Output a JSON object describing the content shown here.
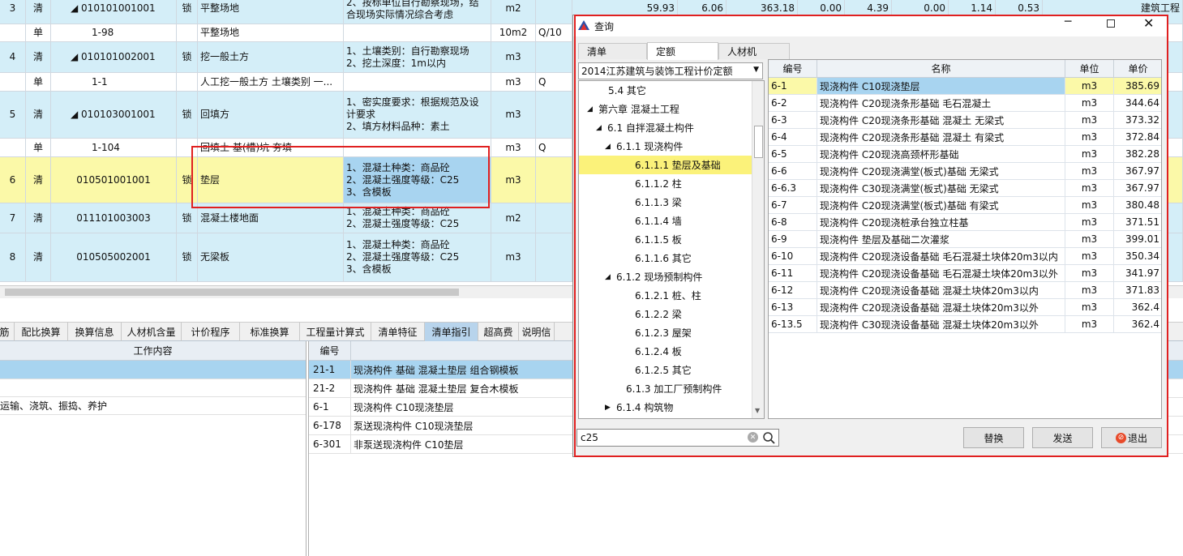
{
  "grid": {
    "rows": [
      {
        "no": "3",
        "type": "清",
        "code": "◢ 010101001001",
        "lock": "锁",
        "name": "平整场地",
        "feature": "2、按标单位自行勘察现场，结合现场实际情况综合考虑",
        "unit": "m2",
        "qty": "",
        "n1": "59.93",
        "n2": "6.06",
        "n3": "363.18",
        "n4": "0.00",
        "n5": "4.39",
        "n6": "0.00",
        "n7": "1.14",
        "n8": "0.53",
        "cat": "建筑工程"
      },
      {
        "no": "",
        "type": "单",
        "code": "1-98",
        "lock": "",
        "name": "平整场地",
        "feature": "",
        "unit": "10m2",
        "qty": "Q/10"
      },
      {
        "no": "4",
        "type": "清",
        "code": "◢ 010101002001",
        "lock": "锁",
        "name": "挖一般土方",
        "feature": "1、土壤类别：自行勘察现场\n2、挖土深度：1m以内",
        "unit": "m3",
        "qty": ""
      },
      {
        "no": "",
        "type": "单",
        "code": "1-1",
        "lock": "",
        "name": "人工挖一般土方 土壤类别 一...",
        "feature": "",
        "unit": "m3",
        "qty": "Q"
      },
      {
        "no": "5",
        "type": "清",
        "code": "◢ 010103001001",
        "lock": "锁",
        "name": "回填方",
        "feature": "1、密实度要求：根据规范及设计要求\n2、填方材料品种：素土",
        "unit": "m3",
        "qty": ""
      },
      {
        "no": "",
        "type": "单",
        "code": "1-104",
        "lock": "",
        "name": "回填土 基(槽)坑 夯填",
        "feature": "",
        "unit": "m3",
        "qty": "Q"
      },
      {
        "no": "6",
        "type": "清",
        "code": "010501001001",
        "lock": "锁",
        "name": "垫层",
        "feature": "1、混凝土种类：商品砼\n2、混凝土强度等级：C25\n3、含模板",
        "unit": "m3",
        "qty": ""
      },
      {
        "no": "7",
        "type": "清",
        "code": "011101003003",
        "lock": "锁",
        "name": "混凝土楼地面",
        "feature": "1、混凝土种类：商品砼\n2、混凝土强度等级：C25",
        "unit": "m2",
        "qty": ""
      },
      {
        "no": "8",
        "type": "清",
        "code": "010505002001",
        "lock": "锁",
        "name": "无梁板",
        "feature": "1、混凝土种类：商品砼\n2、混凝土强度等级：C25\n3、含模板",
        "unit": "m3",
        "qty": ""
      }
    ]
  },
  "tabs": [
    "筋",
    "配比换算",
    "换算信息",
    "人材机含量",
    "计价程序",
    "标准换算",
    "工程量计算式",
    "清单特征",
    "清单指引",
    "超高费",
    "说明信"
  ],
  "active_tab": "清单指引",
  "left_panel": {
    "header": "工作内容",
    "rows": [
      "",
      "",
      "运输、浇筑、振捣、养护"
    ]
  },
  "right_panel": {
    "header_code": "编号",
    "rows": [
      {
        "code": "21-1",
        "name": "现浇构件 基础 混凝土垫层 组合钢模板"
      },
      {
        "code": "21-2",
        "name": "现浇构件 基础 混凝土垫层 复合木模板"
      },
      {
        "code": "6-1",
        "name": "现浇构件  C10现浇垫层"
      },
      {
        "code": "6-178",
        "name": "泵送现浇构件  C10现浇垫层"
      },
      {
        "code": "6-301",
        "name": "非泵送现浇构件  C10垫层"
      }
    ]
  },
  "dialog": {
    "title": "查询",
    "tabs": [
      "清单",
      "定额",
      "人材机"
    ],
    "active_tab": "定额",
    "combo": "2014江苏建筑与装饰工程计价定额",
    "tree": [
      {
        "label": "5.4 其它",
        "indent": 0,
        "exp": ""
      },
      {
        "label": "第六章 混凝土工程",
        "indent": 0,
        "exp": "◢"
      },
      {
        "label": "6.1 自拌混凝土构件",
        "indent": 1,
        "exp": "◢"
      },
      {
        "label": "6.1.1 现浇构件",
        "indent": 2,
        "exp": "◢"
      },
      {
        "label": "6.1.1.1 垫层及基础",
        "indent": 3,
        "exp": "",
        "sel": true
      },
      {
        "label": "6.1.1.2 柱",
        "indent": 3,
        "exp": ""
      },
      {
        "label": "6.1.1.3 梁",
        "indent": 3,
        "exp": ""
      },
      {
        "label": "6.1.1.4 墙",
        "indent": 3,
        "exp": ""
      },
      {
        "label": "6.1.1.5 板",
        "indent": 3,
        "exp": ""
      },
      {
        "label": "6.1.1.6 其它",
        "indent": 3,
        "exp": ""
      },
      {
        "label": "6.1.2 现场预制构件",
        "indent": 2,
        "exp": "◢"
      },
      {
        "label": "6.1.2.1 桩、柱",
        "indent": 3,
        "exp": ""
      },
      {
        "label": "6.1.2.2 梁",
        "indent": 3,
        "exp": ""
      },
      {
        "label": "6.1.2.3 屋架",
        "indent": 3,
        "exp": ""
      },
      {
        "label": "6.1.2.4 板",
        "indent": 3,
        "exp": ""
      },
      {
        "label": "6.1.2.5 其它",
        "indent": 3,
        "exp": ""
      },
      {
        "label": "6.1.3 加工厂预制构件",
        "indent": 2,
        "exp": ""
      },
      {
        "label": "6.1.4 构筑物",
        "indent": 2,
        "exp": "▶"
      }
    ],
    "table_headers": [
      "编号",
      "名称",
      "单位",
      "单价"
    ],
    "table_rows": [
      {
        "code": "6-1",
        "name": "现浇构件  C10现浇垫层",
        "unit": "m3",
        "price": "385.69"
      },
      {
        "code": "6-2",
        "name": "现浇构件  C20现浇条形基础 毛石混凝土",
        "unit": "m3",
        "price": "344.64"
      },
      {
        "code": "6-3",
        "name": "现浇构件  C20现浇条形基础 混凝土 无梁式",
        "unit": "m3",
        "price": "373.32"
      },
      {
        "code": "6-4",
        "name": "现浇构件  C20现浇条形基础 混凝土 有梁式",
        "unit": "m3",
        "price": "372.84"
      },
      {
        "code": "6-5",
        "name": "现浇构件  C20现浇高颈杯形基础",
        "unit": "m3",
        "price": "382.28"
      },
      {
        "code": "6-6",
        "name": "现浇构件  C20现浇满堂(板式)基础 无梁式",
        "unit": "m3",
        "price": "367.97"
      },
      {
        "code": "6-6.3",
        "name": "现浇构件  C30现浇满堂(板式)基础 无梁式",
        "unit": "m3",
        "price": "367.97"
      },
      {
        "code": "6-7",
        "name": "现浇构件  C20现浇满堂(板式)基础 有梁式",
        "unit": "m3",
        "price": "380.48"
      },
      {
        "code": "6-8",
        "name": "现浇构件  C20现浇桩承台独立柱基",
        "unit": "m3",
        "price": "371.51"
      },
      {
        "code": "6-9",
        "name": "现浇构件  垫层及基础二次灌浆",
        "unit": "m3",
        "price": "399.01"
      },
      {
        "code": "6-10",
        "name": "现浇构件  C20现浇设备基础 毛石混凝土块体20m3以内",
        "unit": "m3",
        "price": "350.34"
      },
      {
        "code": "6-11",
        "name": "现浇构件  C20现浇设备基础 毛石混凝土块体20m3以外",
        "unit": "m3",
        "price": "341.97"
      },
      {
        "code": "6-12",
        "name": "现浇构件  C20现浇设备基础 混凝土块体20m3以内",
        "unit": "m3",
        "price": "371.83"
      },
      {
        "code": "6-13",
        "name": "现浇构件  C20现浇设备基础 混凝土块体20m3以外",
        "unit": "m3",
        "price": "362.4"
      },
      {
        "code": "6-13.5",
        "name": "现浇构件  C30现浇设备基础 混凝土块体20m3以外",
        "unit": "m3",
        "price": "362.4"
      }
    ],
    "search_value": "c25",
    "btn_replace": "替换",
    "btn_send": "发送",
    "btn_exit": "退出"
  },
  "colors": {
    "selected_tree": "#fbf27a",
    "highlight_row": "#fbf9a8",
    "grid_row": "#d4eef8",
    "red_box": "#e02020",
    "active_tab": "#b8d4ec"
  }
}
